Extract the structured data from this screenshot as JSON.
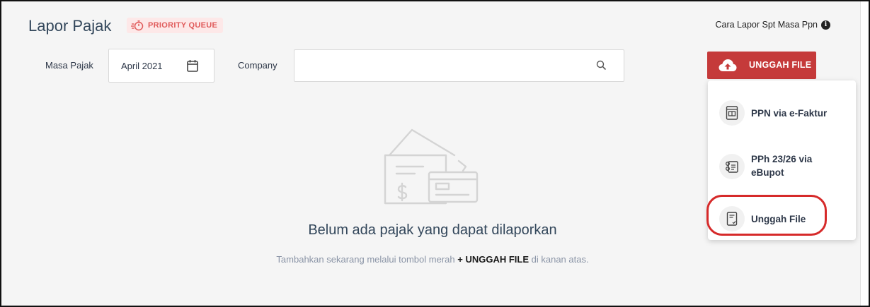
{
  "header": {
    "title": "Lapor Pajak",
    "badge": "PRIORITY QUEUE",
    "help_link": "Cara Lapor Spt Masa Ppn"
  },
  "filters": {
    "masa_pajak_label": "Masa Pajak",
    "masa_pajak_value": "April 2021",
    "company_label": "Company",
    "company_value": "",
    "company_placeholder": ""
  },
  "upload": {
    "button_label": "UNGGAH FILE",
    "menu": [
      {
        "line1": "PPN via e-Faktur",
        "line2": ""
      },
      {
        "line1": "PPh 23/26 via",
        "line2": "eBupot"
      },
      {
        "line1": "Unggah File",
        "line2": ""
      }
    ]
  },
  "empty_state": {
    "title": "Belum ada pajak yang dapat dilaporkan",
    "hint_prefix": "Tambahkan sekarang melalui tombol merah",
    "hint_bold": "+ UNGGAH FILE",
    "hint_suffix": "di kanan atas."
  },
  "colors": {
    "accent": "#c53a3a",
    "badge_bg": "#fde8e8",
    "badge_text": "#e05a5a",
    "highlight": "#d62a2a"
  },
  "icons": {
    "badge": "stopwatch-icon",
    "help": "info-icon",
    "masa_pajak": "calendar-icon",
    "company": "search-icon",
    "upload": "cloud-upload-icon",
    "menu": [
      "efaktur-document-icon",
      "ebupot-document-icon",
      "file-check-icon"
    ]
  }
}
